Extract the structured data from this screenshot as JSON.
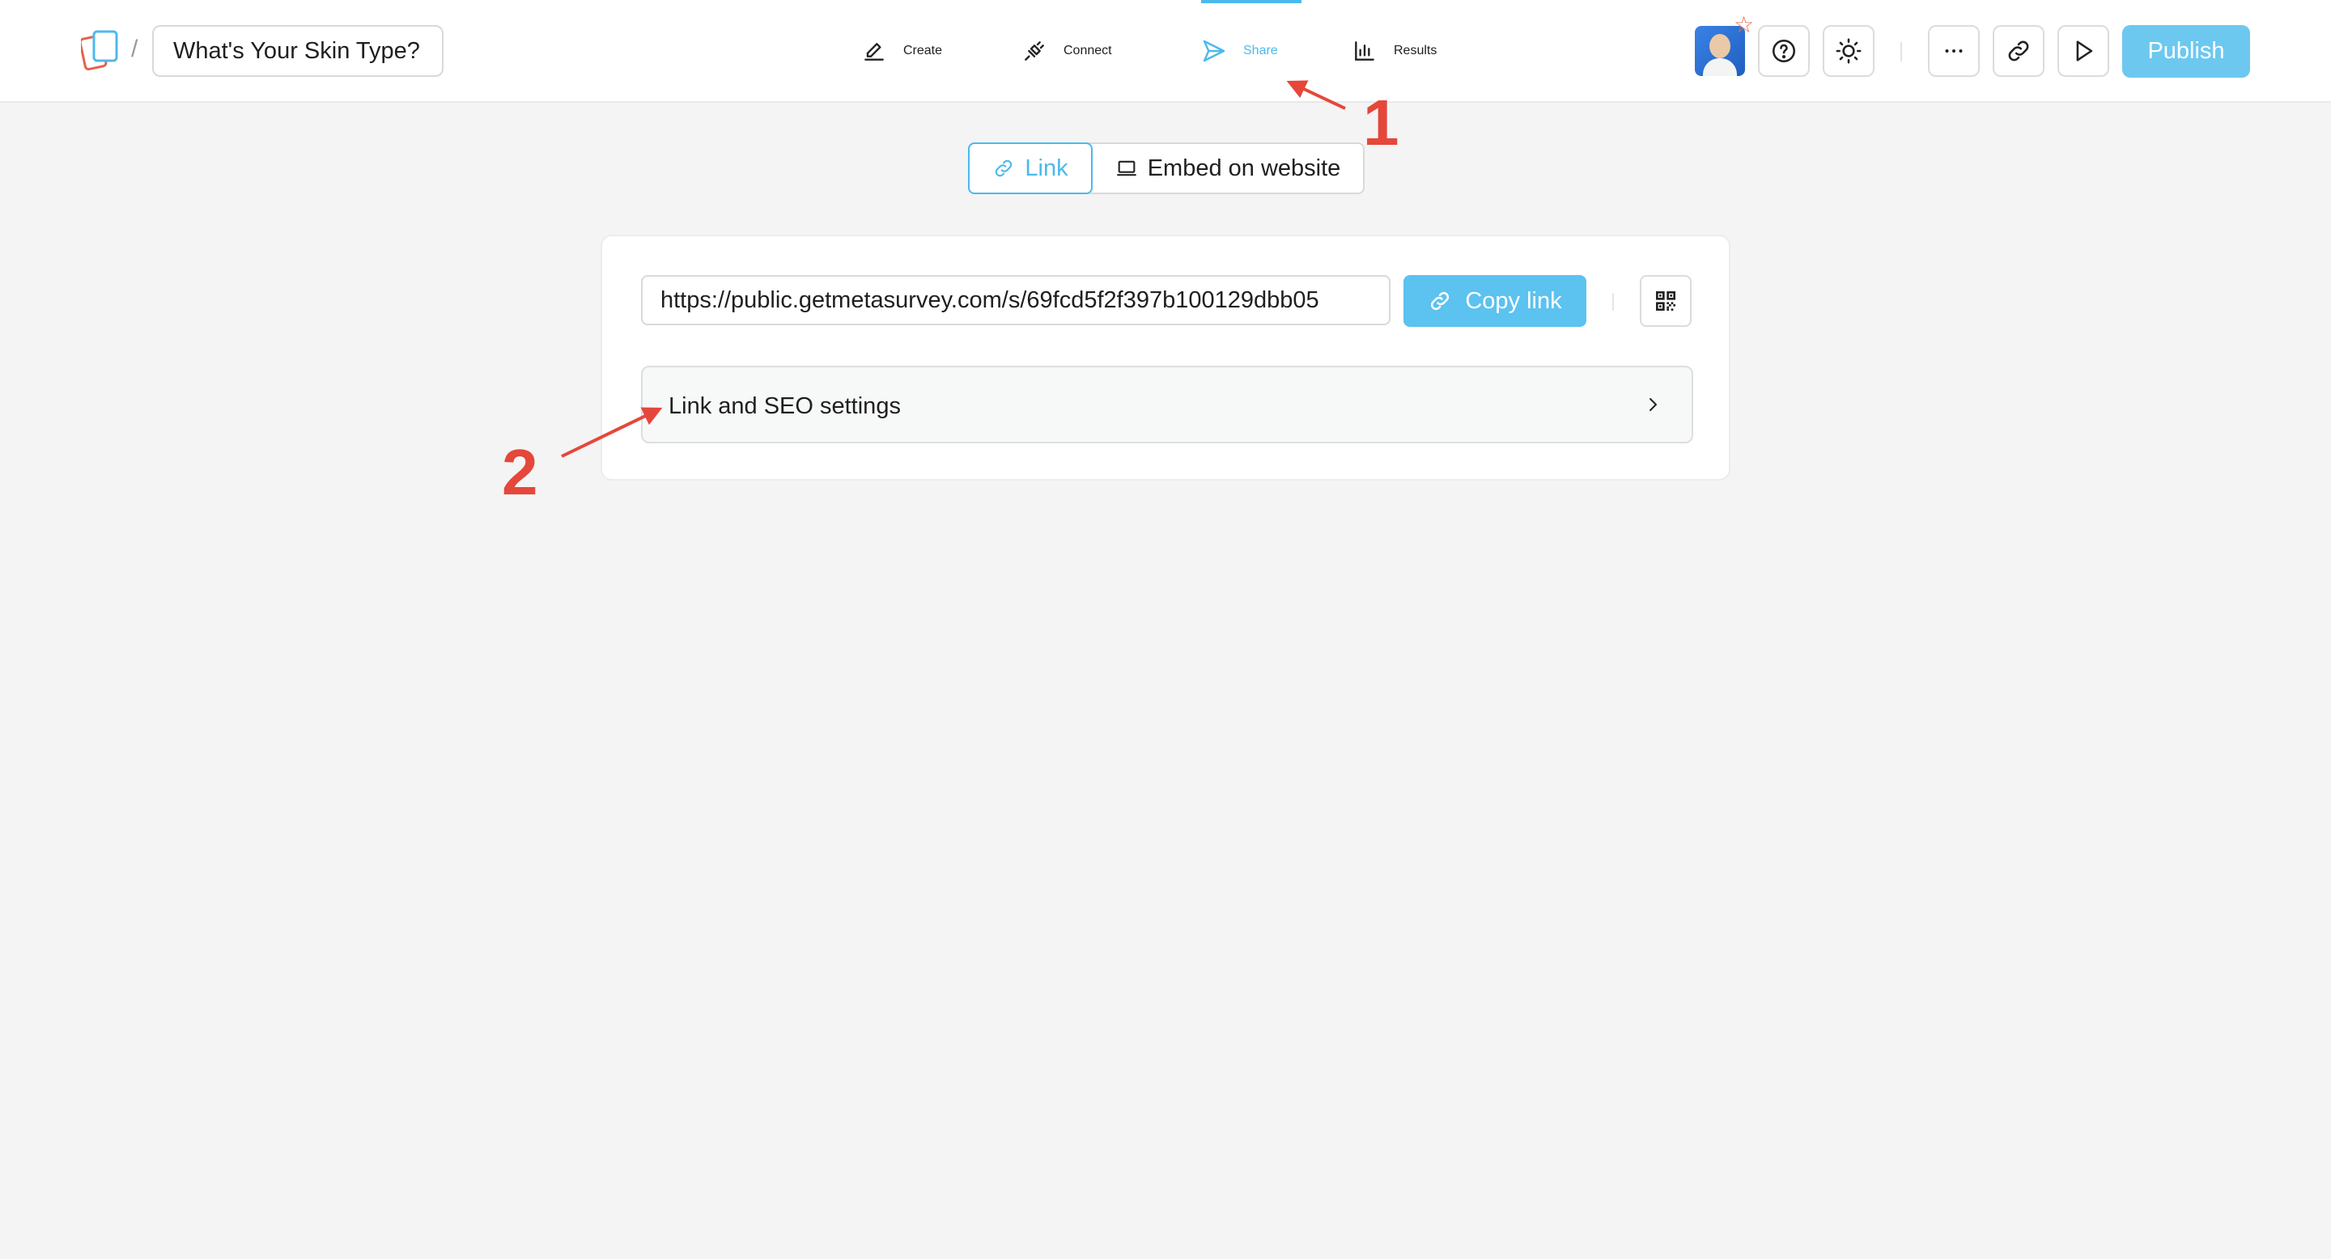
{
  "header": {
    "breadcrumb_separator": "/",
    "form_title": "What's Your Skin Type?",
    "nav": [
      {
        "label": "Create",
        "icon": "pencil-icon"
      },
      {
        "label": "Connect",
        "icon": "plug-icon"
      },
      {
        "label": "Share",
        "icon": "send-icon",
        "active": true
      },
      {
        "label": "Results",
        "icon": "bar-chart-icon"
      }
    ],
    "publish_label": "Publish",
    "star_glyph": "☆"
  },
  "share_tabs": [
    {
      "label": "Link",
      "icon": "link-icon",
      "active": true
    },
    {
      "label": "Embed on website",
      "icon": "laptop-icon",
      "active": false
    }
  ],
  "share_card": {
    "url_value": "https://public.getmetasurvey.com/s/69fcd5f2f397b100129dbb05",
    "copy_label": "Copy link",
    "settings_label": "Link and SEO settings"
  },
  "annotations": [
    {
      "label": "1"
    },
    {
      "label": "2"
    }
  ],
  "colors": {
    "accent": "#4cb9ec",
    "publish_bg": "#6dc8f0",
    "annotation": "#e5473a",
    "page_bg": "#f4f4f4"
  }
}
